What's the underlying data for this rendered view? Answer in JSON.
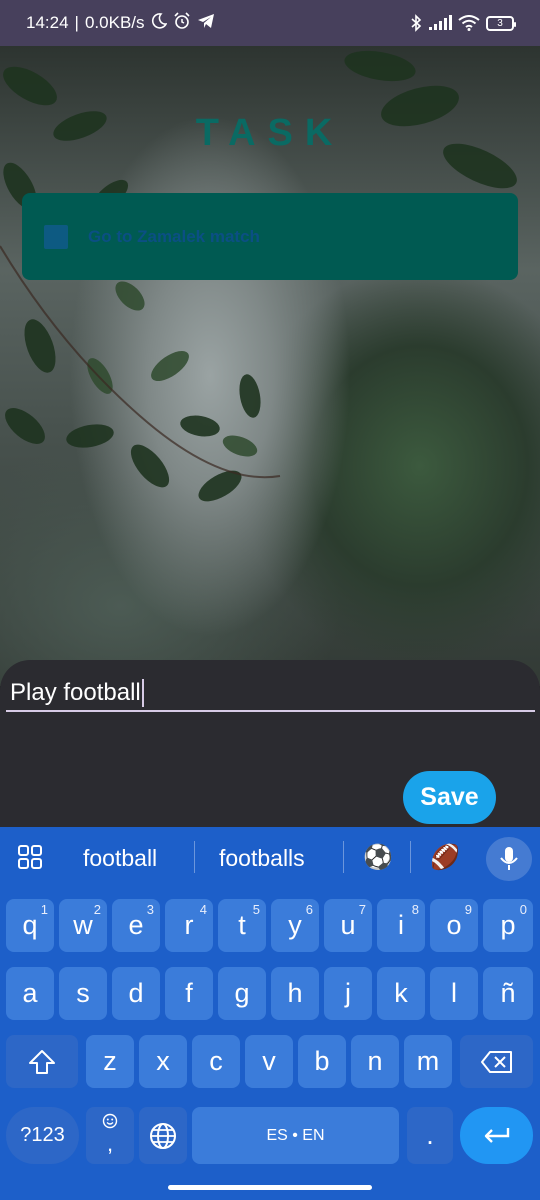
{
  "status_bar": {
    "time": "14:24",
    "network_speed": "0.0KB/s",
    "battery_level": "3",
    "icons": [
      "moon-icon",
      "alarm-icon",
      "telegram-icon",
      "bluetooth-icon",
      "signal-icon",
      "wifi-icon",
      "battery-icon"
    ]
  },
  "app": {
    "title": "TASK",
    "tasks": [
      {
        "text": "Go to Zamalek match",
        "checked": false
      }
    ]
  },
  "sheet": {
    "input_value": "Play football",
    "save_label": "Save"
  },
  "keyboard": {
    "suggestions": [
      "football",
      "footballs"
    ],
    "emoji_suggestions": [
      "⚽",
      "🏈"
    ],
    "row1": [
      {
        "key": "q",
        "hint": "1"
      },
      {
        "key": "w",
        "hint": "2"
      },
      {
        "key": "e",
        "hint": "3"
      },
      {
        "key": "r",
        "hint": "4"
      },
      {
        "key": "t",
        "hint": "5"
      },
      {
        "key": "y",
        "hint": "6"
      },
      {
        "key": "u",
        "hint": "7"
      },
      {
        "key": "i",
        "hint": "8"
      },
      {
        "key": "o",
        "hint": "9"
      },
      {
        "key": "p",
        "hint": "0"
      }
    ],
    "row2": [
      "a",
      "s",
      "d",
      "f",
      "g",
      "h",
      "j",
      "k",
      "l",
      "ñ"
    ],
    "row3": [
      "z",
      "x",
      "c",
      "v",
      "b",
      "n",
      "m"
    ],
    "symbols_label": "?123",
    "comma_label": ",",
    "space_label": "ES • EN",
    "period_label": ".",
    "accent_color": "#1d5fc9"
  }
}
